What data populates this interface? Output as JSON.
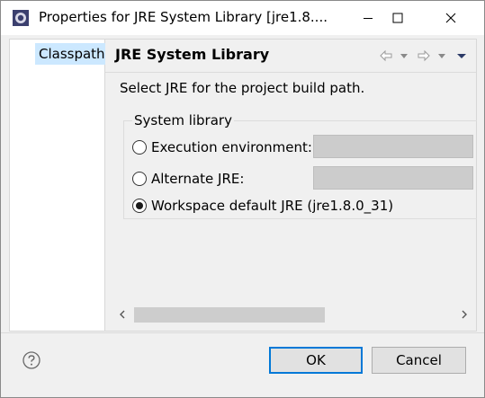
{
  "window": {
    "title": "Properties for JRE System Library [jre1.8....",
    "controls": [
      "minimize",
      "maximize",
      "close"
    ]
  },
  "nav": {
    "items": [
      {
        "label": "Classpath",
        "selected": true
      }
    ]
  },
  "page": {
    "title": "JRE System Library",
    "description": "Select JRE for the project build path.",
    "history_icons": [
      "back-arrow-icon",
      "dropdown-icon",
      "forward-arrow-icon",
      "dropdown-icon",
      "view-menu-icon"
    ]
  },
  "group": {
    "label": "System library",
    "options": [
      {
        "label": "Execution environment:",
        "checked": false,
        "combo_value": "",
        "combo_enabled": false
      },
      {
        "label": "Alternate JRE:",
        "checked": false,
        "combo_value": "",
        "combo_enabled": false
      },
      {
        "label": "Workspace default JRE (jre1.8.0_31)",
        "checked": true
      }
    ]
  },
  "footer": {
    "help_icon": "help-icon",
    "ok_label": "OK",
    "cancel_label": "Cancel"
  },
  "colors": {
    "selection": "#cce8ff",
    "accent": "#0078d7",
    "window_bg": "#f0f0f0",
    "disabled_combo": "#cccccc"
  }
}
